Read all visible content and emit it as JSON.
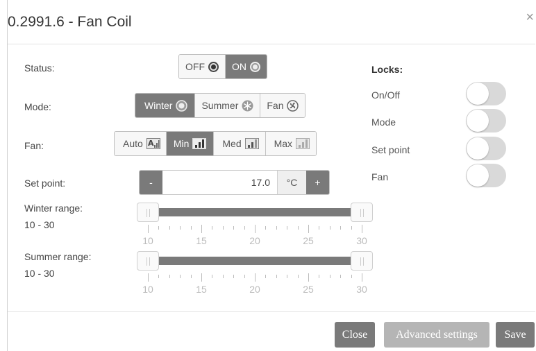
{
  "dialog": {
    "title": "0.2991.6 - Fan Coil",
    "close_icon": "close-icon"
  },
  "status": {
    "label": "Status:",
    "options": [
      "OFF",
      "ON"
    ],
    "selected": "ON"
  },
  "mode": {
    "label": "Mode:",
    "options": [
      "Winter",
      "Summer",
      "Fan"
    ],
    "selected": "Winter"
  },
  "fan": {
    "label": "Fan:",
    "options": [
      "Auto",
      "Min",
      "Med",
      "Max"
    ],
    "selected": "Min"
  },
  "setpoint": {
    "label": "Set point:",
    "minus": "-",
    "value": "17.0",
    "unit": "°C",
    "plus": "+"
  },
  "winter_range": {
    "label": "Winter range:",
    "value_text": "10 - 30",
    "min": 10,
    "max": 30,
    "low": 10,
    "high": 30,
    "tick_labels": [
      "10",
      "15",
      "20",
      "25",
      "30"
    ]
  },
  "summer_range": {
    "label": "Summer range:",
    "value_text": "10 - 30",
    "min": 10,
    "max": 30,
    "low": 10,
    "high": 30,
    "tick_labels": [
      "10",
      "15",
      "20",
      "25",
      "30"
    ]
  },
  "locks": {
    "title": "Locks:",
    "items": [
      {
        "label": "On/Off",
        "on": false
      },
      {
        "label": "Mode",
        "on": false
      },
      {
        "label": "Set point",
        "on": false
      },
      {
        "label": "Fan",
        "on": false
      }
    ]
  },
  "footer": {
    "close": "Close",
    "advanced": "Advanced settings",
    "save": "Save"
  },
  "colors": {
    "active": "#7a7a7a",
    "disabled_button": "#b5b5b5"
  }
}
